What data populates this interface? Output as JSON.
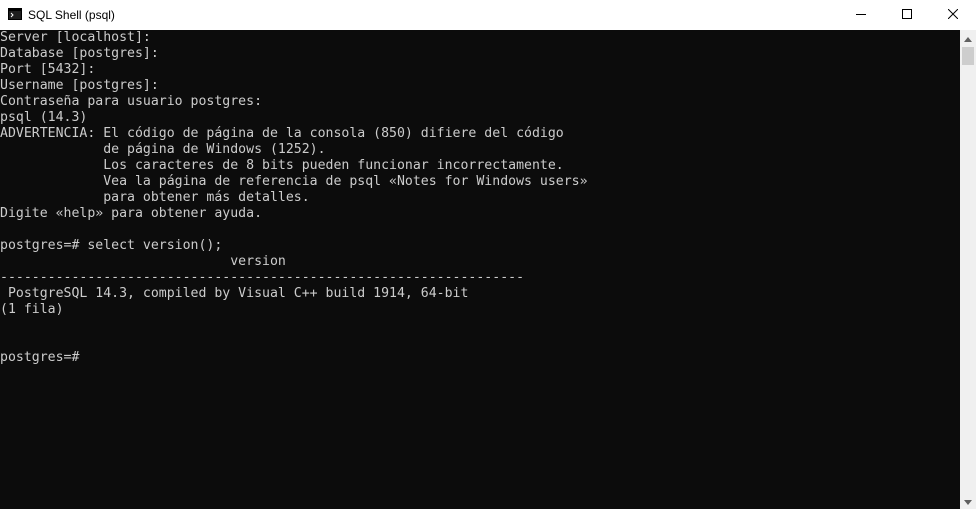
{
  "window": {
    "title": "SQL Shell (psql)",
    "icons": {
      "app": "terminal-icon",
      "minimize": "minimize-icon",
      "maximize": "maximize-icon",
      "close": "close-icon"
    }
  },
  "terminal": {
    "background": "#0c0c0c",
    "foreground": "#cccccc",
    "lines": [
      "Server [localhost]:",
      "Database [postgres]:",
      "Port [5432]:",
      "Username [postgres]:",
      "Contraseña para usuario postgres:",
      "psql (14.3)",
      "ADVERTENCIA: El código de página de la consola (850) difiere del código",
      "             de página de Windows (1252).",
      "             Los caracteres de 8 bits pueden funcionar incorrectamente.",
      "             Vea la página de referencia de psql «Notes for Windows users»",
      "             para obtener más detalles.",
      "Digite «help» para obtener ayuda.",
      "",
      "postgres=# select version();",
      "                             version",
      "------------------------------------------------------------------",
      " PostgreSQL 14.3, compiled by Visual C++ build 1914, 64-bit",
      "(1 fila)",
      "",
      "",
      "postgres=#"
    ]
  },
  "scrollbar": {
    "up_icon": "scroll-up-arrow-icon",
    "down_icon": "scroll-down-arrow-icon"
  }
}
